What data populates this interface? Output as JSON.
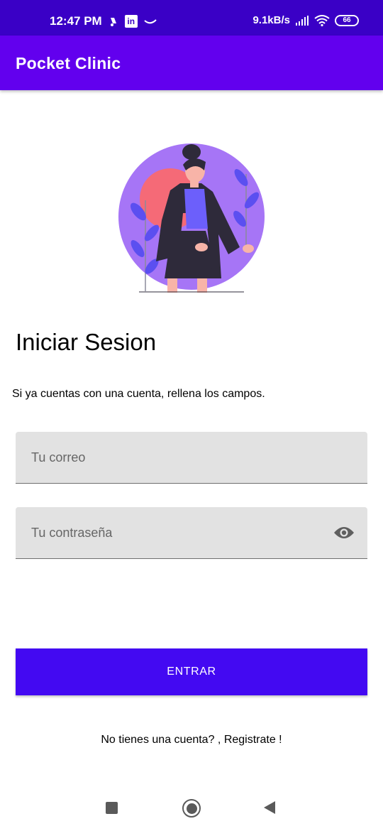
{
  "status_bar": {
    "time": "12:47 PM",
    "network_speed": "9.1kB/s",
    "battery_level": "66",
    "left_icons": [
      "notification-icon",
      "linkedin-icon",
      "tilde-icon"
    ],
    "right_icons": [
      "signal-icon",
      "wifi-icon",
      "battery-icon"
    ]
  },
  "app_bar": {
    "title": "Pocket Clinic"
  },
  "illustration": {
    "name": "woman-illustration"
  },
  "login": {
    "heading": "Iniciar Sesion",
    "subtitle": "Si ya cuentas con una cuenta, rellena los campos.",
    "email_placeholder": "Tu correo",
    "email_value": "",
    "password_placeholder": "Tu contraseña",
    "password_value": "",
    "password_toggle_icon": "eye-icon",
    "submit_label": "ENTRAR",
    "register_text": "No tienes una cuenta? , Registrate !"
  },
  "nav_bar": {
    "icons": [
      "recents-icon",
      "home-icon",
      "back-icon"
    ]
  },
  "colors": {
    "status_bar": "#3a00c6",
    "app_bar": "#6200ee",
    "button": "#4309f2",
    "field_bg": "#e2e2e2",
    "circle": "#a675f6",
    "sun": "#f56a77"
  }
}
